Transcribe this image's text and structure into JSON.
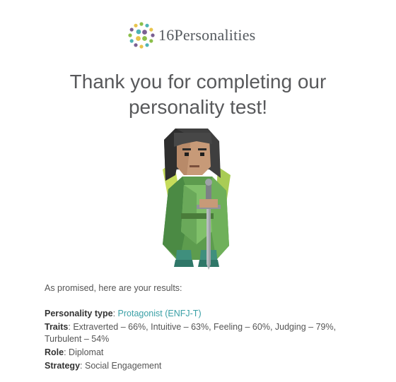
{
  "brand": {
    "name": "16Personalities",
    "colors": {
      "text": "#555a5f",
      "teal": "#4fb3b5",
      "green": "#8bbf4a",
      "yellow": "#e8c44b",
      "purple": "#7a5f93"
    }
  },
  "heading": {
    "text": "Thank you for completing our personality test!"
  },
  "illustration": {
    "icon": "protagonist-character-icon"
  },
  "intro": {
    "text": "As promised, here are your results:"
  },
  "results": {
    "personality_type": {
      "label": "Personality type",
      "value": "Protagonist (ENFJ-T)"
    },
    "traits": {
      "label": "Traits",
      "value": "Extraverted – 66%, Intuitive – 63%, Feeling – 60%, Judging – 79%, Turbulent – 54%"
    },
    "role": {
      "label": "Role",
      "value": "Diplomat"
    },
    "strategy": {
      "label": "Strategy",
      "value": "Social Engagement"
    }
  },
  "separator": ": "
}
